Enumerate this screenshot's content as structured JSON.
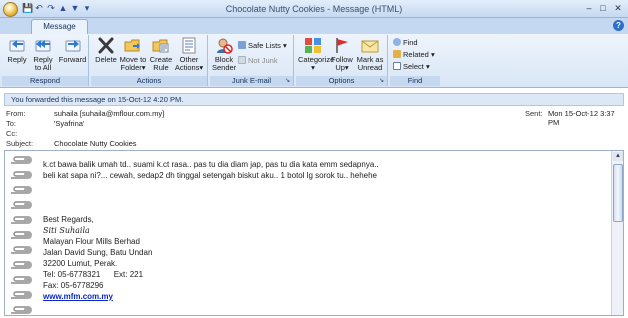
{
  "window": {
    "title": "Chocolate Nutty Cookies - Message (HTML)",
    "controls": {
      "minimize": "–",
      "maximize": "□",
      "close": "✕"
    }
  },
  "quick_access": {
    "save": "💾",
    "undo": "↶",
    "redo": "↷",
    "up": "▲",
    "down": "▼",
    "customize": "▾"
  },
  "tabs": [
    {
      "label": "Message"
    }
  ],
  "help": "?",
  "ribbon": {
    "groups": {
      "respond": "Respond",
      "actions": "Actions",
      "junk": "Junk E-mail",
      "options": "Options",
      "find": "Find"
    },
    "buttons": {
      "reply": "Reply",
      "reply_all_1": "Reply",
      "reply_all_2": "to All",
      "forward": "Forward",
      "delete": "Delete",
      "move_1": "Move to",
      "move_2": "Folder",
      "create_1": "Create",
      "create_2": "Rule",
      "other_1": "Other",
      "other_2": "Actions",
      "block_1": "Block",
      "block_2": "Sender",
      "safe_lists": "Safe Lists",
      "not_junk": "Not Junk",
      "categorize": "Categorize",
      "follow_1": "Follow",
      "follow_2": "Up",
      "mark_1": "Mark as",
      "mark_2": "Unread",
      "find": "Find",
      "related": "Related",
      "select": "Select"
    },
    "dropdown_arrow": "▾"
  },
  "infobar": "You forwarded this message on 15-Oct-12 4:20 PM.",
  "header": {
    "from_label": "From:",
    "from_value": "suhaila [suhaila@mflour.com.my]",
    "to_label": "To:",
    "to_value": "'Syafrina'",
    "cc_label": "Cc:",
    "cc_value": "",
    "subject_label": "Subject:",
    "subject_value": "Chocolate Nutty Cookies",
    "sent_label": "Sent:",
    "sent_value": "Mon 15-Oct-12 3:37 PM"
  },
  "body": {
    "line1": "k.ct bawa balik umah td.. suami k.ct rasa.. pas tu dia diam jap, pas tu dia kata emm sedapnya..",
    "line2": "beli kat sapa ni?... cewah, sedap2 dh tinggal setengah biskut aku.. 1 botol lg sorok tu.. hehehe"
  },
  "signature": {
    "closing": "Best Regards,",
    "name_script": "Siti Suhaila",
    "company": "Malayan Flour Mills Berhad",
    "address1": "Jalan David Sung, Batu Undan",
    "address2": "32200 Lumut, Perak.",
    "tel": "Tel: 05-6778321      Ext: 221",
    "fax": "Fax: 05-6778296",
    "website": "www.mfm.com.my"
  },
  "scrollbar": {
    "up_arrow": "▲"
  },
  "colors": {
    "ribbon_bg": "#dce8f7",
    "link": "#0b27c8",
    "accent": "#15315b"
  }
}
